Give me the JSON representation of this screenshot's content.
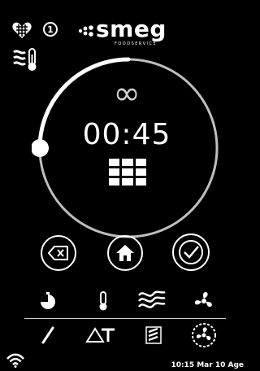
{
  "header": {
    "badge_number": "1",
    "brand": "smeg",
    "brand_sub": "FOODSERVICE"
  },
  "timer": {
    "mode_symbol": "∞",
    "time": "00:45",
    "progress_fraction": 0.25
  },
  "actions": [
    {
      "name": "delete-button",
      "icon": "backspace-icon"
    },
    {
      "name": "home-button",
      "icon": "home-icon"
    },
    {
      "name": "confirm-button",
      "icon": "checkmark-icon"
    }
  ],
  "toolbar_row1": [
    "timer-icon",
    "thermometer-icon",
    "steam-icon",
    "fan-icon"
  ],
  "toolbar_row2": [
    "probe-icon",
    "delta-t-icon",
    "humidity-icon",
    "fan-speed-icon"
  ],
  "status": {
    "wifi_icon": "wifi-icon",
    "datetime": "10:15 Mar 10 Age"
  },
  "colors": {
    "background": "#000000",
    "foreground": "#ffffff",
    "track": "#bfbfbf"
  }
}
